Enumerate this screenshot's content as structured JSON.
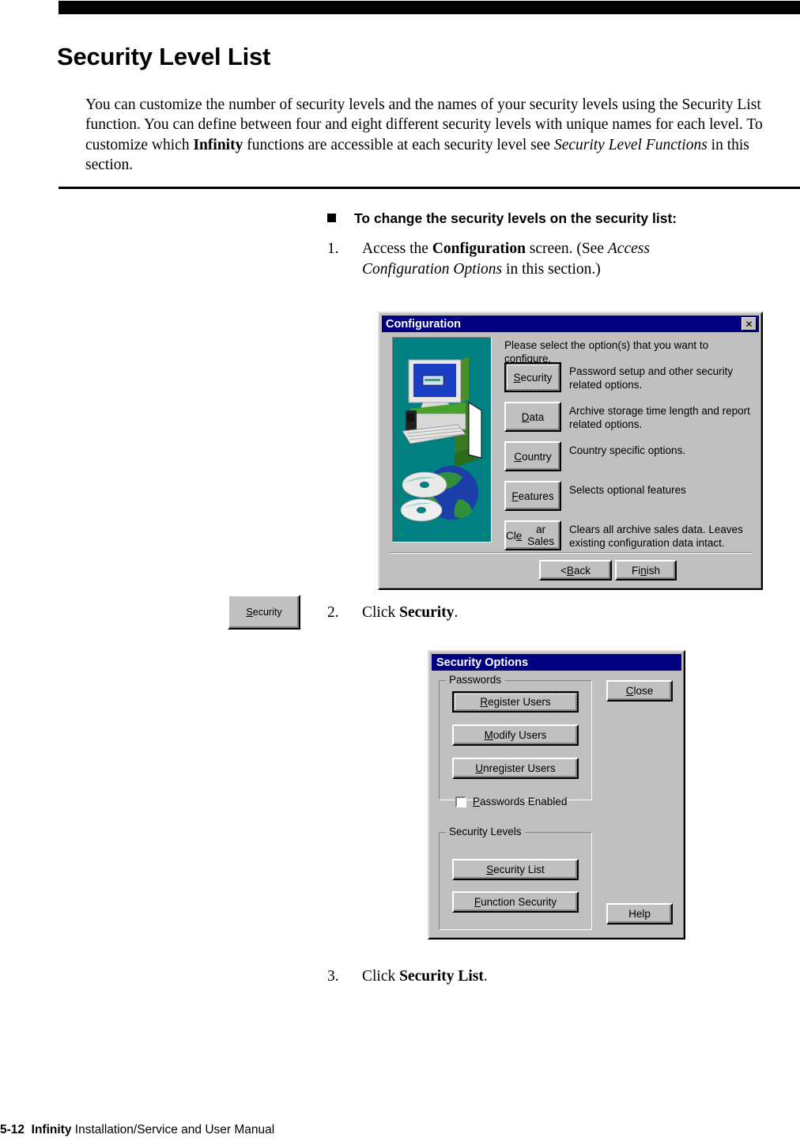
{
  "page": {
    "title": "Security Level List",
    "intro_parts": [
      {
        "t": "You can customize the number of security levels and the names of your security levels using the Security List function. You can define between four and eight different security levels with unique names for each level. To customize which ",
        "s": "normal"
      },
      {
        "t": "Infinity",
        "s": "bold"
      },
      {
        "t": " functions are accessible at each security level see ",
        "s": "normal"
      },
      {
        "t": "Security Level Functions",
        "s": "italic"
      },
      {
        "t": " in this section.",
        "s": "normal"
      }
    ],
    "procedure_heading": "To change the security levels on the security list:",
    "steps": [
      {
        "number": "1.",
        "parts": [
          {
            "t": "Access the ",
            "s": "normal"
          },
          {
            "t": "Configuration",
            "s": "bold"
          },
          {
            "t": " screen. (See ",
            "s": "normal"
          },
          {
            "t": "Access Configuration Options",
            "s": "italic"
          },
          {
            "t": " in this section.)",
            "s": "normal"
          }
        ]
      },
      {
        "number": "2.",
        "parts": [
          {
            "t": "Click ",
            "s": "normal"
          },
          {
            "t": "Security",
            "s": "bold"
          },
          {
            "t": ".",
            "s": "normal"
          }
        ]
      },
      {
        "number": "3.",
        "parts": [
          {
            "t": "Click ",
            "s": "normal"
          },
          {
            "t": "Security List",
            "s": "bold"
          },
          {
            "t": ".",
            "s": "normal"
          }
        ]
      }
    ],
    "margin_button": {
      "prefix": "S",
      "rest": "ecurity",
      "full": "Security"
    },
    "footer": {
      "page_number": "5-12",
      "product": "Infinity",
      "manual": "Installation/Service and User Manual"
    }
  },
  "config_dialog": {
    "title": "Configuration",
    "close_icon": "close-icon",
    "close_glyph": "✕",
    "prompt": "Please select the option(s) that you want to configure.",
    "art_alt": "computer-monitor-globe-cd-illustration",
    "options": [
      {
        "accel": "S",
        "rest": "ecurity",
        "label": "Security",
        "description": "Password setup and other security related options.",
        "default": true
      },
      {
        "accel": "D",
        "rest": "ata",
        "label": "Data",
        "description": "Archive storage time length and report related options.",
        "default": false
      },
      {
        "accel": "C",
        "rest": "ountry",
        "label": "Country",
        "description": "Country specific options.",
        "default": false
      },
      {
        "accel": "F",
        "rest": "eatures",
        "label": "Features",
        "description": "Selects optional features",
        "default": false
      },
      {
        "accel_pre": "Cl",
        "accel": "e",
        "rest": "ar Sales",
        "label": "Clear Sales",
        "description": "Clears all archive sales data.  Leaves existing configuration data intact.",
        "default": false
      }
    ],
    "nav_buttons": [
      {
        "pre": "< ",
        "accel": "B",
        "rest": "ack",
        "label": "< Back"
      },
      {
        "pre": "Fi",
        "accel": "n",
        "rest": "ish",
        "label": "Finish"
      }
    ],
    "colors": {
      "titlebar": "#000080",
      "face": "#c0c0c0",
      "art_background": "#008080"
    }
  },
  "security_options_dialog": {
    "title": "Security Options",
    "groups": [
      {
        "label": "Passwords",
        "buttons": [
          {
            "accel": "R",
            "rest": "egister Users",
            "label": "Register Users",
            "default": true
          },
          {
            "accel": "M",
            "rest": "odify Users",
            "label": "Modify Users",
            "default": false
          },
          {
            "accel": "U",
            "rest": "nregister Users",
            "label": "Unregister Users",
            "default": false
          }
        ],
        "checkbox": {
          "accel": "P",
          "rest": "asswords Enabled",
          "label": "Passwords Enabled",
          "checked": false
        }
      },
      {
        "label": "Security Levels",
        "buttons": [
          {
            "accel": "S",
            "rest": "ecurity List",
            "label": "Security List",
            "default": false
          },
          {
            "accel": "F",
            "rest": "unction Security",
            "label": "Function Security",
            "default": false
          }
        ]
      }
    ],
    "side_buttons": [
      {
        "accel": "C",
        "rest": "lose",
        "label": "Close"
      },
      {
        "accel": "",
        "rest": "Help",
        "label": "Help"
      }
    ],
    "colors": {
      "titlebar": "#000080",
      "face": "#c0c0c0"
    }
  }
}
